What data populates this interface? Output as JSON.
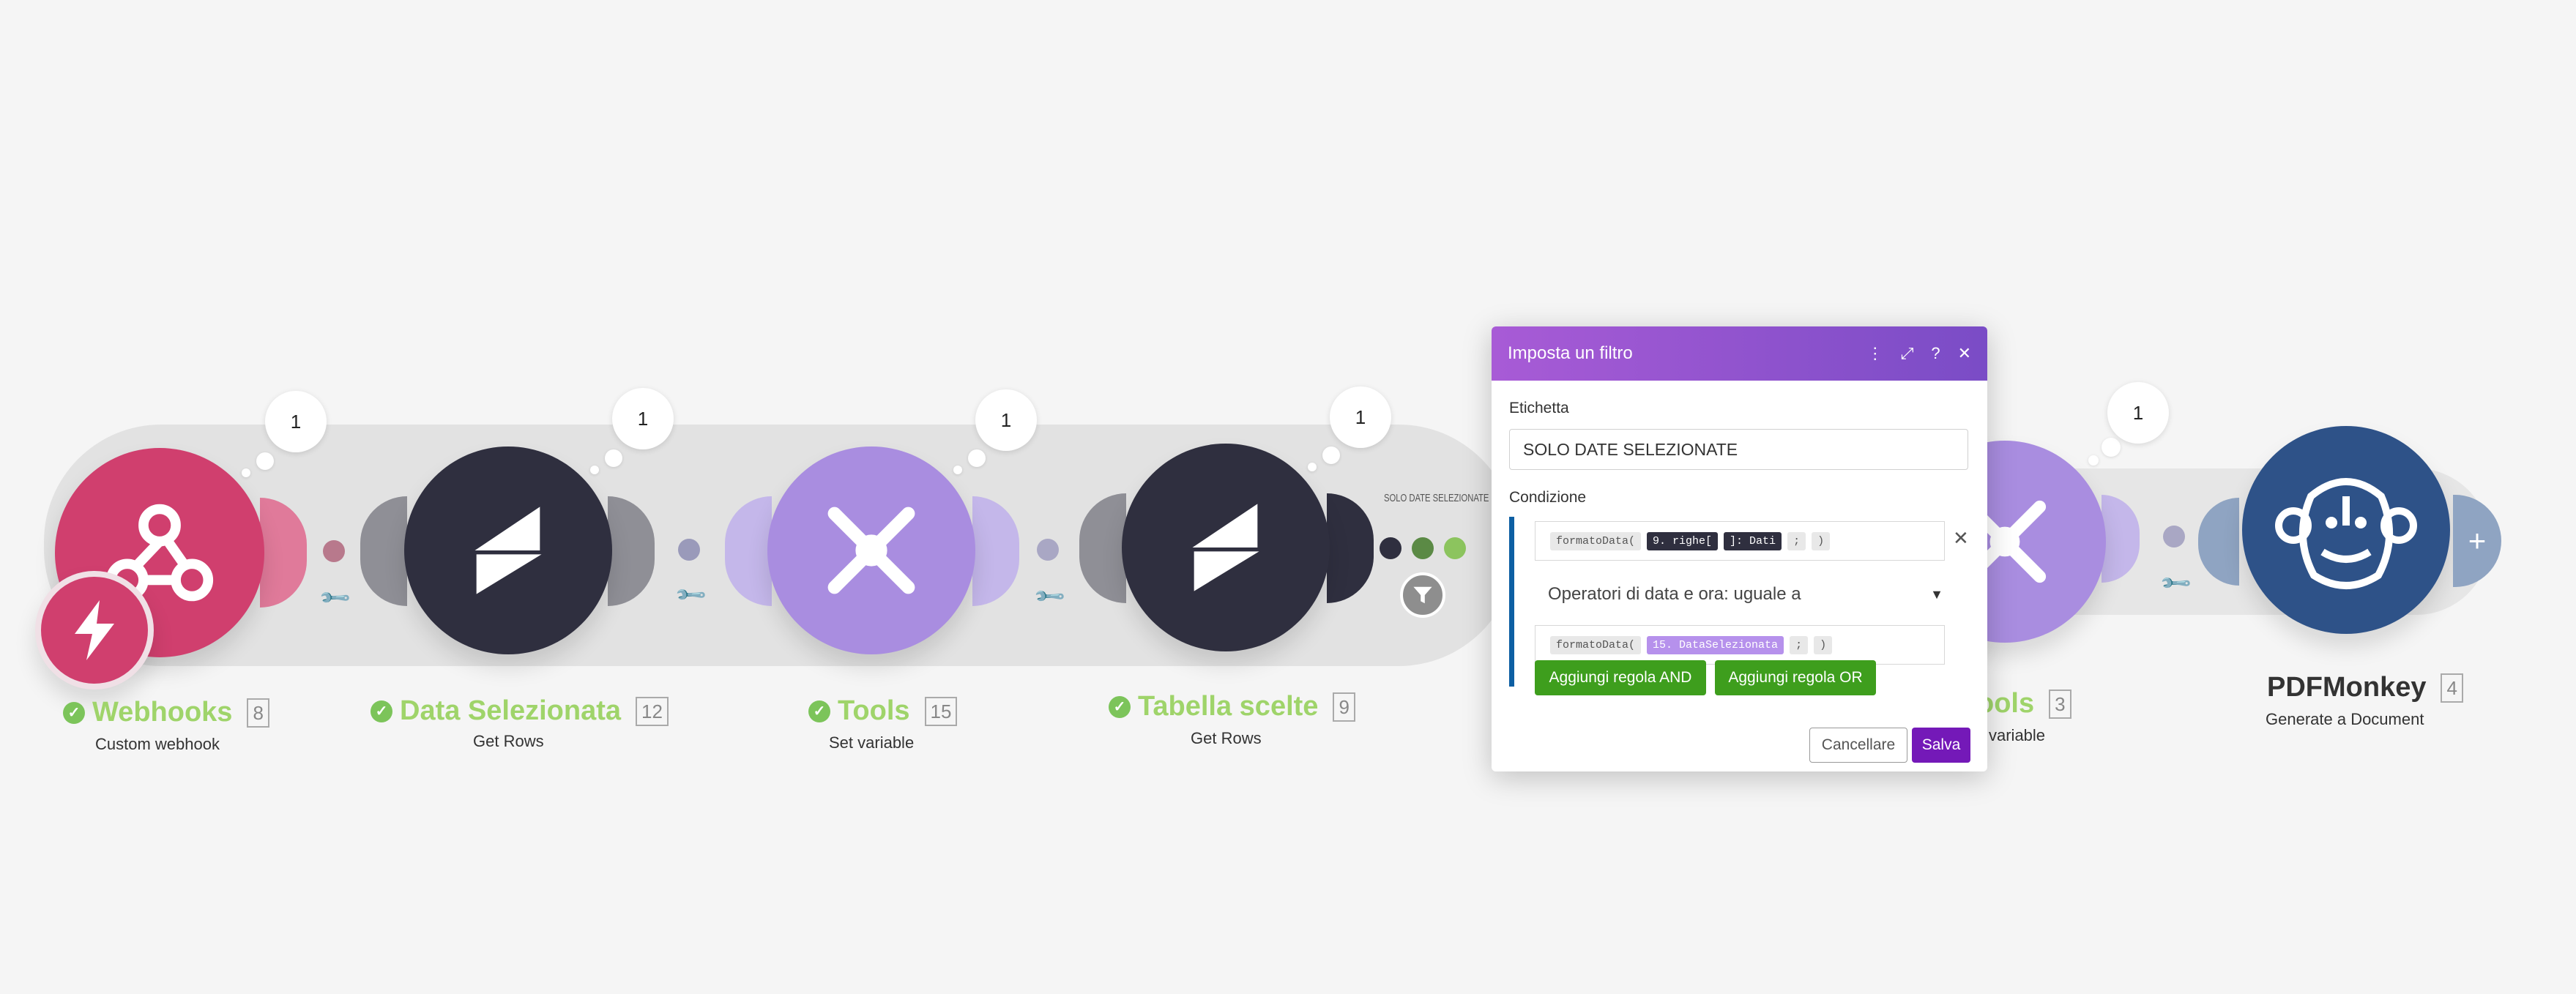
{
  "modules": [
    {
      "name": "Webhooks",
      "id": "8",
      "subtitle": "Custom webhook",
      "bubble": "1"
    },
    {
      "name": "Data Selezionata",
      "id": "12",
      "subtitle": "Get Rows",
      "bubble": "1"
    },
    {
      "name": "Tools",
      "id": "15",
      "subtitle": "Set variable",
      "bubble": "1"
    },
    {
      "name": "Tabella scelte",
      "id": "9",
      "subtitle": "Get Rows",
      "bubble": "1"
    },
    {
      "name": "ools",
      "id": "3",
      "subtitle": "variable",
      "bubble": "1"
    },
    {
      "name": "PDFMonkey",
      "id": "4",
      "subtitle": "Generate a Document"
    }
  ],
  "filter_label_on_route": "SOLO DATE SELEZIONATE",
  "dialog": {
    "title": "Imposta un filtro",
    "label_caption": "Etichetta",
    "label_value": "SOLO DATE SELEZIONATE",
    "condition_caption": "Condizione",
    "field1": {
      "fn": "formatoData(",
      "a": "9. righe[",
      "b": "]: Dati",
      "c": ";",
      "d": ")"
    },
    "operator": "Operatori di data e ora: uguale a",
    "field2": {
      "fn": "formatoData(",
      "a": "15. DataSelezionata",
      "c": ";",
      "d": ")"
    },
    "add_and": "Aggiungi regola AND",
    "add_or": "Aggiungi regola OR",
    "cancel": "Cancellare",
    "save": "Salva"
  },
  "colors": {
    "webhook": "#d03f6e",
    "dark": "#2f2f3f",
    "tools": "#a98de0",
    "pdf": "#2e5288",
    "green": "#3e9e1d",
    "save": "#7419b8"
  }
}
